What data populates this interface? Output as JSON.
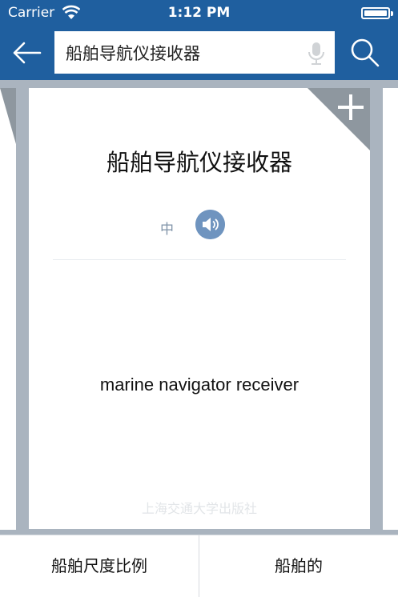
{
  "status_bar": {
    "carrier": "Carrier",
    "time": "1:12 PM"
  },
  "nav": {
    "search_value": "船舶导航仪接收器"
  },
  "card": {
    "term": "船舶导航仪接收器",
    "lang_label": "中",
    "translation": "marine navigator receiver",
    "publisher": "上海交通大学出版社"
  },
  "bottom": {
    "prev_label": "船舶尺度比例",
    "next_label": "船舶的"
  },
  "colors": {
    "nav_bar": "#1f5f9f",
    "background": "#aab4bf",
    "speaker": "#6f94bf",
    "corner_fold": "#8e979f"
  }
}
